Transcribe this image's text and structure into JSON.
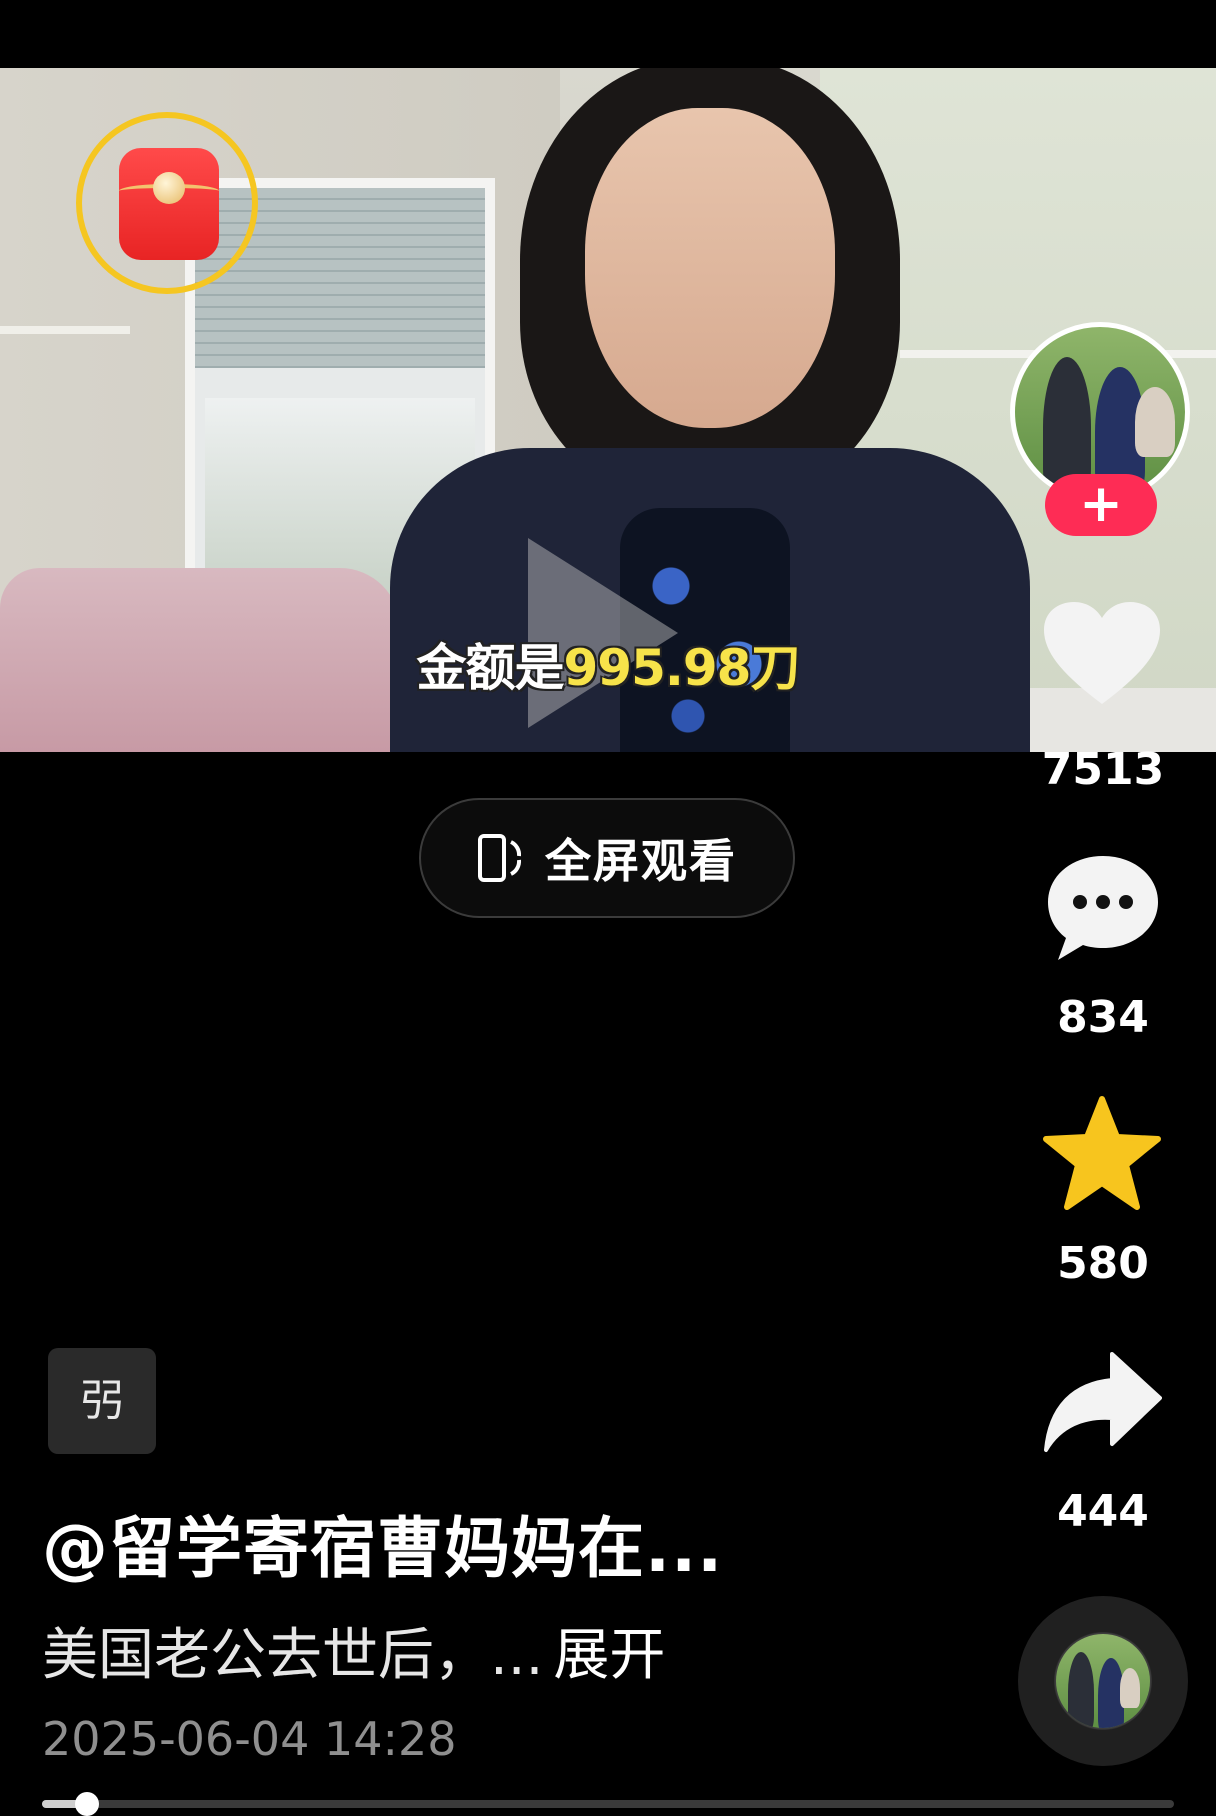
{
  "video": {
    "subtitle_white": "金额是",
    "subtitle_yellow": "995.98刀"
  },
  "fullscreen": {
    "label": "全屏观看",
    "icon": "fullscreen-rotate-icon"
  },
  "rail": {
    "follow_label": "+",
    "likes": "7513",
    "comments": "834",
    "favorites": "580",
    "shares": "444"
  },
  "info": {
    "tag": "弜",
    "author": "@留学寄宿曹妈妈在...",
    "description": "美国老公去世后，...",
    "expand": "展开",
    "date": "2025-06-04 14:28"
  },
  "progress": {
    "played_fraction": 0.04
  },
  "colors": {
    "accent_red": "#fe2c55",
    "subtitle_yellow": "#f7e34a",
    "star": "#f7c51e",
    "ring": "#f5c621"
  }
}
